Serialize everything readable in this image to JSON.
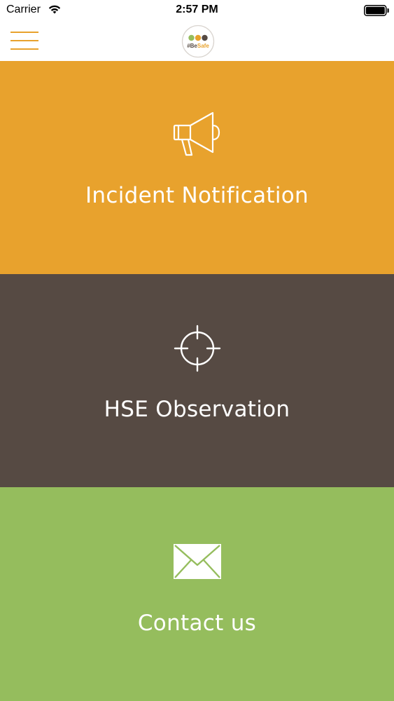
{
  "status_bar": {
    "carrier": "Carrier",
    "time": "2:57 PM"
  },
  "nav": {
    "menu_icon": "hamburger-menu-icon",
    "logo_text": "#BeSafe",
    "accent_color": "#e8a22d"
  },
  "tiles": [
    {
      "label": "Incident Notification",
      "icon": "megaphone-icon",
      "color": "#e8a22d"
    },
    {
      "label": "HSE Observation",
      "icon": "crosshair-icon",
      "color": "#564a43"
    },
    {
      "label": "Contact us",
      "icon": "envelope-icon",
      "color": "#95bd5d"
    }
  ]
}
